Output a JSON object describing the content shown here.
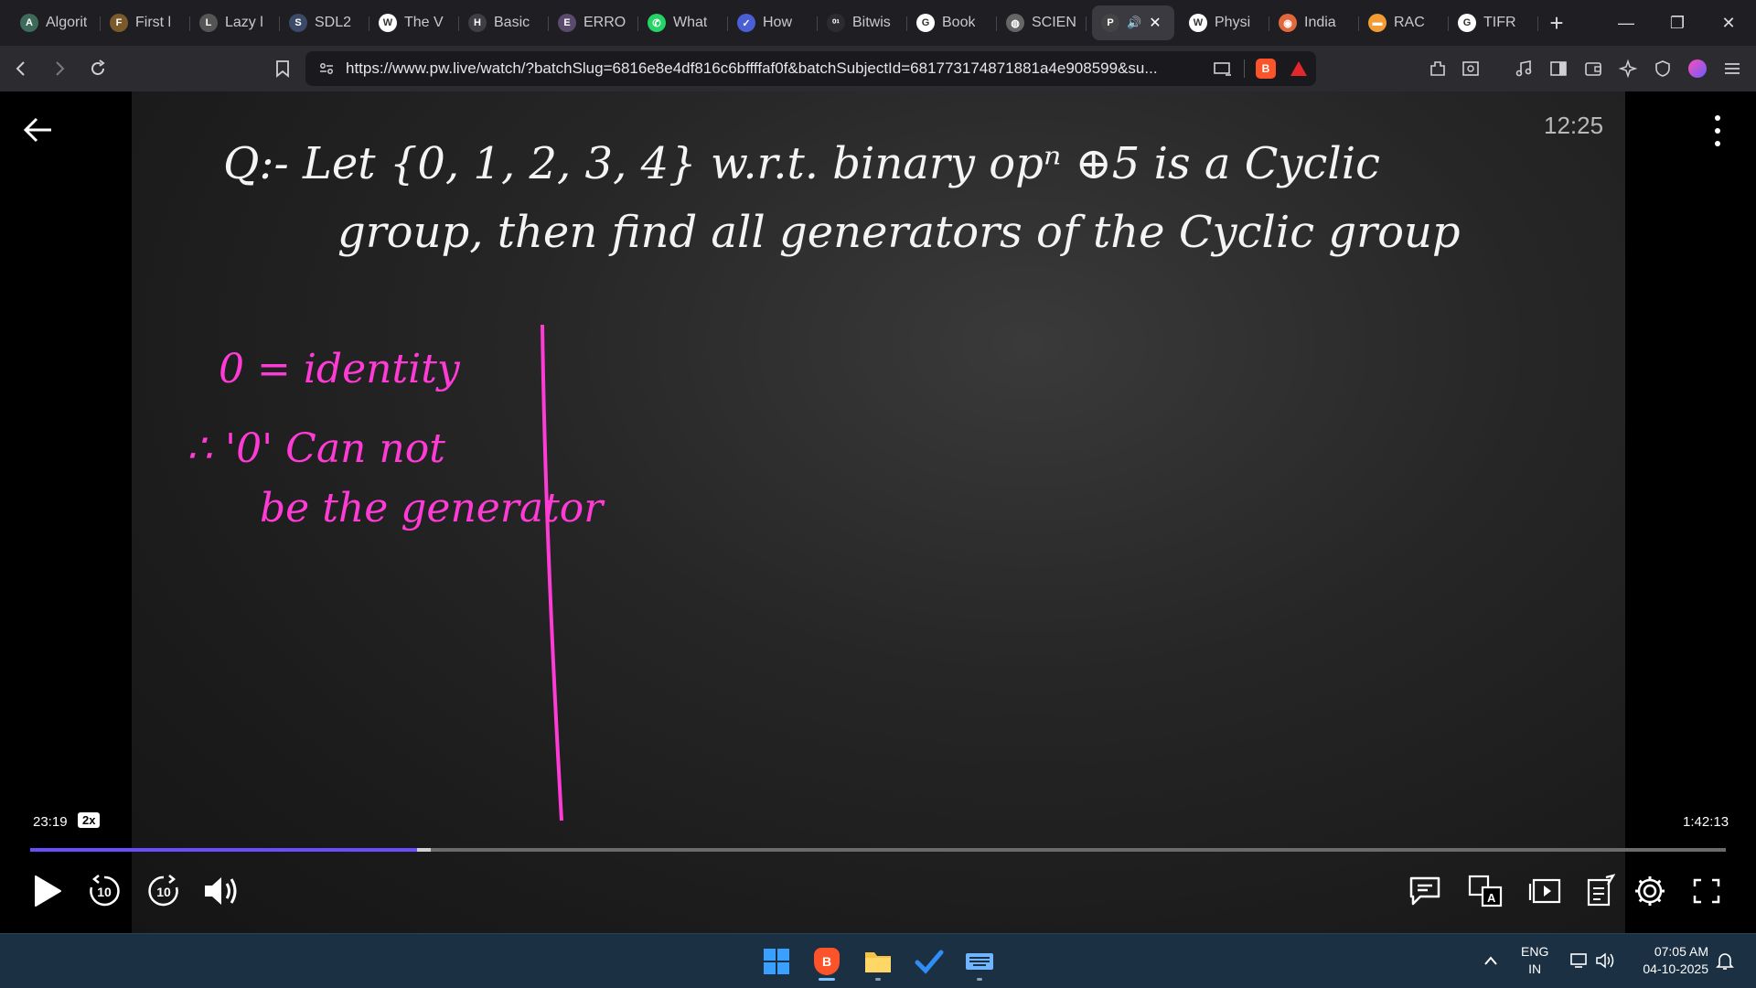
{
  "tabs": [
    {
      "title": "Algorit",
      "favicon": "algo-icon",
      "color": "#3d6b5a",
      "glyph": "A"
    },
    {
      "title": "First l",
      "favicon": "first-icon",
      "color": "#7a5a2a",
      "glyph": "F"
    },
    {
      "title": "Lazy l",
      "favicon": "lazy-icon",
      "color": "#555",
      "glyph": "L"
    },
    {
      "title": "SDL2",
      "favicon": "sdl-icon",
      "color": "#3b4a66",
      "glyph": "S"
    },
    {
      "title": "The V",
      "favicon": "wikipedia-icon",
      "color": "#ffffff",
      "glyph": "W"
    },
    {
      "title": "Basic",
      "favicon": "basic-icon",
      "color": "#3e3e44",
      "glyph": "H"
    },
    {
      "title": "ERRO",
      "favicon": "error-icon",
      "color": "#5a4a6e",
      "glyph": "E"
    },
    {
      "title": "What",
      "favicon": "whatsapp-icon",
      "color": "#25d366",
      "glyph": "✆"
    },
    {
      "title": "How",
      "favicon": "how-icon",
      "color": "#4a5fd6",
      "glyph": "✓"
    },
    {
      "title": "Bitwis",
      "favicon": "bitwise-icon",
      "color": "#2b2b30",
      "glyph": "⁰¹"
    },
    {
      "title": "Book",
      "favicon": "google-icon",
      "color": "#ffffff",
      "glyph": "G"
    },
    {
      "title": "SCIEN",
      "favicon": "globe-icon",
      "color": "#666",
      "glyph": "◍"
    },
    {
      "title": "",
      "favicon": "pw-icon",
      "color": "#444",
      "glyph": "P",
      "active": true
    },
    {
      "title": "Physi",
      "favicon": "physics-icon",
      "color": "#fff",
      "glyph": "W"
    },
    {
      "title": "India",
      "favicon": "india-icon",
      "color": "#e2683c",
      "glyph": "◉"
    },
    {
      "title": "RAC",
      "favicon": "flag-icon",
      "color": "#f39c34",
      "glyph": "▬"
    },
    {
      "title": "TIFR",
      "favicon": "google-icon",
      "color": "#ffffff",
      "glyph": "G"
    }
  ],
  "url": "https://www.pw.live/watch/?batchSlug=6816e8e4df816c6bffffaf0f&batchSubjectId=681773174871881a4e908599&su...",
  "video": {
    "clock": "12:25",
    "current_time": "23:19",
    "speed": "2x",
    "total_time": "1:42:13",
    "progress_fraction": 0.228,
    "buffer_fraction": 0.0085,
    "skip_back": "10",
    "skip_forward": "10"
  },
  "board": {
    "question_line1": "Q:- Let {0, 1, 2, 3, 4} w.r.t. binary opⁿ ⊕5 is a Cyclic",
    "question_line2": "group, then find all generators of the Cyclic group",
    "note_line1": "0 = identity",
    "note_line2": "∴ '0' Can not",
    "note_line3": "be the generator"
  },
  "taskbar": {
    "lang_top": "ENG",
    "lang_bottom": "IN",
    "time": "07:05 AM",
    "date": "04-10-2025"
  }
}
